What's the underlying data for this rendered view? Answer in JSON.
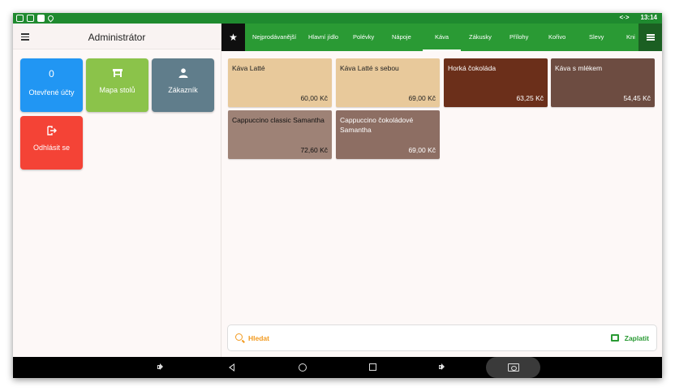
{
  "status_bar": {
    "time": "13:14",
    "network_glyph": "<·>"
  },
  "sidebar": {
    "title": "Administrátor",
    "tiles": [
      {
        "count": "0",
        "label": "Otevřené účty",
        "color": "#2196f3"
      },
      {
        "label": "Mapa stolů",
        "color": "#8bc34a",
        "icon": "table-icon"
      },
      {
        "label": "Zákazník",
        "color": "#607d8b",
        "icon": "person-icon"
      },
      {
        "label": "Odhlásit se",
        "color": "#f44336",
        "icon": "logout-icon"
      }
    ]
  },
  "categories": {
    "tabs": [
      "Nejprodávanější",
      "Hlavní jídlo",
      "Polévky",
      "Nápoje",
      "Káva",
      "Zákusky",
      "Přílohy",
      "Kořivo",
      "Slevy",
      "Kni"
    ],
    "active": "Káva",
    "bar_color": "#2a9a34"
  },
  "products": [
    {
      "name": "Káva Latté",
      "price": "60,00 Kč",
      "color": "#e8c99b",
      "text": "#222222"
    },
    {
      "name": "Káva Latté s sebou",
      "price": "69,00 Kč",
      "color": "#e8c99b",
      "text": "#222222"
    },
    {
      "name": "Horká čokoláda",
      "price": "63,25 Kč",
      "color": "#6b2f1a",
      "text": "#ffffff"
    },
    {
      "name": "Káva s mlékem",
      "price": "54,45 Kč",
      "color": "#6d4c41",
      "text": "#ffffff"
    },
    {
      "name": "Cappuccino classic Samantha",
      "price": "72,60 Kč",
      "color": "#9e8276",
      "text": "#111111"
    },
    {
      "name": "Cappuccino čokoládové Samantha",
      "price": "69,00 Kč",
      "color": "#8d6e63",
      "text": "#ffffff"
    }
  ],
  "bottom": {
    "search_label": "Hledat",
    "pay_label": "Zaplatit"
  }
}
